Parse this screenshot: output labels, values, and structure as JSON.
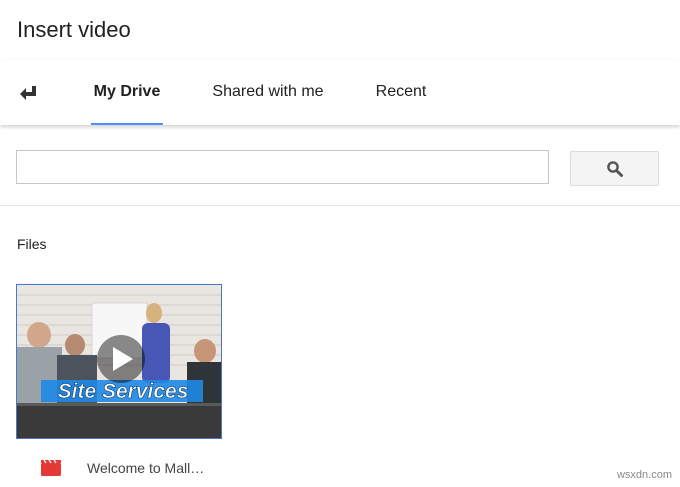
{
  "dialog": {
    "title": "Insert video"
  },
  "tabs": [
    {
      "label": "My Drive",
      "active": true
    },
    {
      "label": "Shared with me",
      "active": false
    },
    {
      "label": "Recent",
      "active": false
    }
  ],
  "search": {
    "value": "",
    "placeholder": ""
  },
  "files": {
    "section_label": "Files",
    "items": [
      {
        "name": "Welcome to Mall…",
        "thumbnail_text": "Site Services",
        "icon": "video-file-icon"
      }
    ]
  },
  "watermark": "wsxdn.com",
  "colors": {
    "accent": "#4d90fe",
    "file_icon": "#e53935",
    "thumbnail_banner": "#1e88e5"
  }
}
